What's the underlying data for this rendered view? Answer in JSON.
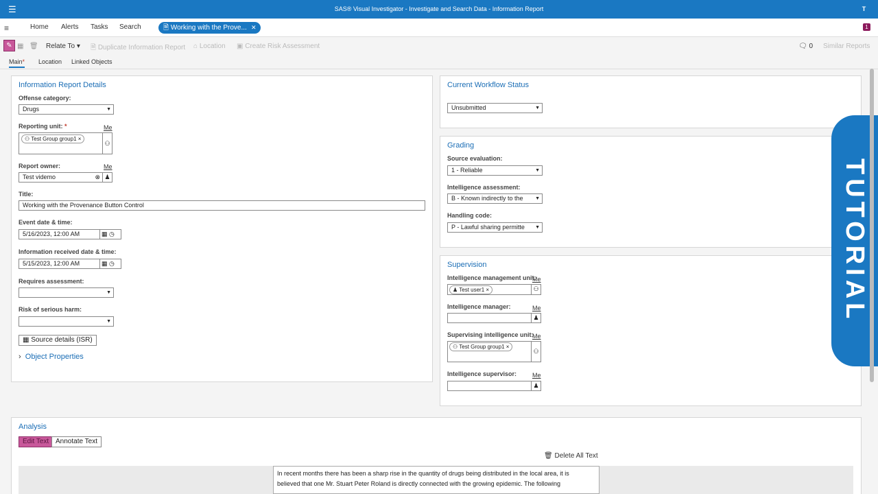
{
  "app": {
    "title": "SAS® Visual Investigator - Investigate and Search Data - Information Report",
    "avatar_letter": "T",
    "menu_icon": "hamburger-icon"
  },
  "nav": {
    "items": [
      "Home",
      "Alerts",
      "Tasks",
      "Search"
    ],
    "doc_tab": "Working with the Prove...",
    "notification_count": "1"
  },
  "toolbar": {
    "relate_to": "Relate To",
    "duplicate": "Duplicate Information Report",
    "location": "Location",
    "risk": "Create Risk Assessment",
    "comment_count": "0",
    "similar": "Similar Reports"
  },
  "tabs": [
    "Main",
    "Location",
    "Linked Objects"
  ],
  "details": {
    "title": "Information Report Details",
    "offense_label": "Offense category:",
    "offense_value": "Drugs",
    "reporting_unit_label": "Reporting unit:",
    "reporting_unit_req": "*",
    "me": "Me",
    "reporting_unit_chip": "Test Group group1",
    "report_owner_label": "Report owner:",
    "report_owner_value": "Test videmo",
    "title_label": "Title:",
    "title_value": "Working with the Provenance Button Control",
    "event_label": "Event date & time:",
    "event_value": "5/16/2023, 12:00 AM",
    "received_label": "Information received date & time:",
    "received_value": "5/15/2023, 12:00 AM",
    "requires_label": "Requires assessment:",
    "risk_label": "Risk of serious harm:",
    "source_button": "Source details (ISR)",
    "object_props": "Object Properties"
  },
  "workflow": {
    "title": "Current Workflow Status",
    "value": "Unsubmitted"
  },
  "grading": {
    "title": "Grading",
    "source_label": "Source evaluation:",
    "source_value": "1 - Reliable",
    "intel_label": "Intelligence assessment:",
    "intel_value": "B - Known indirectly to the",
    "handling_label": "Handling code:",
    "handling_value": "P - Lawful sharing permitte"
  },
  "supervision": {
    "title": "Supervision",
    "imu_label": "Intelligence management unit:",
    "imu_chip": "Test user1",
    "manager_label": "Intelligence manager:",
    "siu_label": "Supervising intelligence unit:",
    "siu_chip": "Test Group group1",
    "supervisor_label": "Intelligence supervisor:",
    "me": "Me"
  },
  "tutorial": "TUTORIAL",
  "analysis": {
    "title": "Analysis",
    "edit_text": "Edit Text",
    "annotate_text": "Annotate Text",
    "delete_all": "Delete All Text",
    "body_line1": "In recent months there has been a sharp rise in the quantity of drugs being distributed in the local area, it is",
    "body_line2": "believed that one Mr. Stuart Peter Roland is directly connected with the growing epidemic. The following"
  },
  "colors": {
    "brand_blue": "#1a78c2",
    "accent_magenta": "#c8589a",
    "link_blue": "#1a6db5"
  }
}
